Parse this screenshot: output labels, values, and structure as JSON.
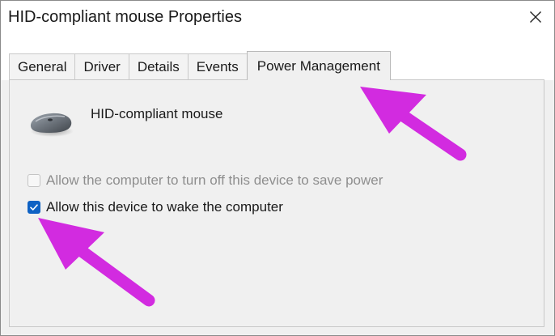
{
  "window": {
    "title": "HID-compliant mouse Properties",
    "close_icon": "close-icon"
  },
  "tabs": [
    {
      "label": "General",
      "active": false
    },
    {
      "label": "Driver",
      "active": false
    },
    {
      "label": "Details",
      "active": false
    },
    {
      "label": "Events",
      "active": false
    },
    {
      "label": "Power Management",
      "active": true
    }
  ],
  "panel": {
    "device_icon": "mouse-icon",
    "device_name": "HID-compliant mouse",
    "options": [
      {
        "label": "Allow the computer to turn off this device to save power",
        "checked": false,
        "enabled": false
      },
      {
        "label": "Allow this device to wake the computer",
        "checked": true,
        "enabled": true
      }
    ]
  },
  "colors": {
    "accent": "#0f62c4",
    "annotation_arrow": "#d22be0"
  }
}
